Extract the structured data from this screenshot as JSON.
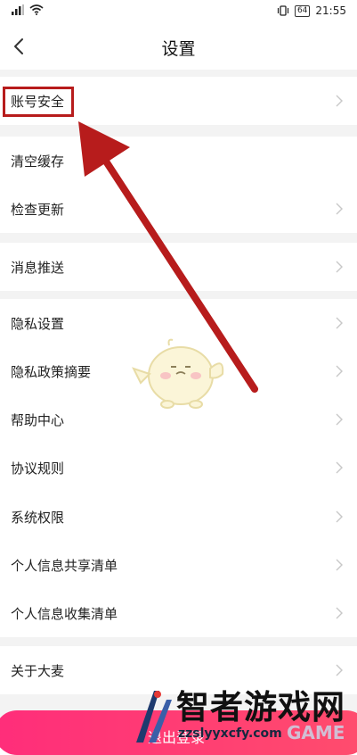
{
  "status_bar": {
    "battery": "64",
    "time": "21:55"
  },
  "header": {
    "title": "设置"
  },
  "list": {
    "account_security": "账号安全",
    "clear_cache": "清空缓存",
    "check_update": "检查更新",
    "message_push": "消息推送",
    "privacy_settings": "隐私设置",
    "privacy_policy_summary": "隐私政策摘要",
    "help_center": "帮助中心",
    "agreement_rules": "协议规则",
    "system_permissions": "系统权限",
    "personal_info_share": "个人信息共享清单",
    "personal_info_collect": "个人信息收集清单",
    "about": "关于大麦"
  },
  "logout": {
    "label": "退出登录"
  },
  "watermark": {
    "title": "智者游戏网",
    "url": "zzslyyxcfy.com",
    "game": "GAME"
  },
  "colors": {
    "highlight": "#b71c1c",
    "logout": "#ff2d7a",
    "divider": "#f3f3f3"
  },
  "icons": [
    "back-arrow-icon",
    "chevron-right-icon",
    "wifi-icon",
    "signal-icon",
    "vibrate-icon",
    "battery-icon"
  ]
}
